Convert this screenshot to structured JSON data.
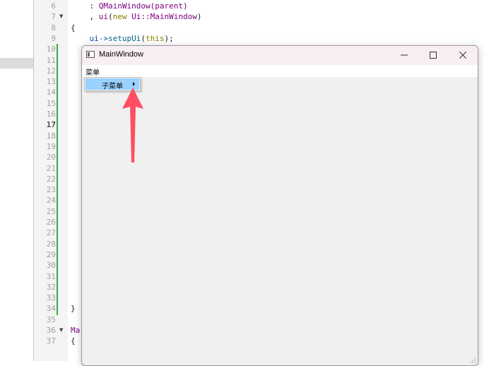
{
  "editor": {
    "lines": [
      {
        "num": "6",
        "tokens": [
          {
            "t": "    : ",
            "c": ""
          },
          {
            "t": "QMainWindow",
            "c": "cls"
          },
          {
            "t": "(parent)",
            "c": "cls"
          }
        ]
      },
      {
        "num": "7",
        "tokens": [
          {
            "t": "    , ",
            "c": ""
          },
          {
            "t": "ui",
            "c": "cls"
          },
          {
            "t": "(",
            "c": ""
          },
          {
            "t": "new",
            "c": "kw"
          },
          {
            "t": " Ui::",
            "c": "cls"
          },
          {
            "t": "MainWindow",
            "c": "cls"
          },
          {
            "t": ")",
            "c": ""
          }
        ]
      },
      {
        "num": "8",
        "tokens": [
          {
            "t": "{",
            "c": ""
          }
        ]
      },
      {
        "num": "9",
        "tokens": [
          {
            "t": "    ui->",
            "c": "var"
          },
          {
            "t": "setupUi",
            "c": "fn"
          },
          {
            "t": "(",
            "c": ""
          },
          {
            "t": "this",
            "c": "kw"
          },
          {
            "t": ");",
            "c": ""
          }
        ]
      },
      {
        "num": "10",
        "tokens": []
      },
      {
        "num": "11",
        "tokens": []
      },
      {
        "num": "12",
        "tokens": []
      },
      {
        "num": "13",
        "tokens": []
      },
      {
        "num": "14",
        "tokens": []
      },
      {
        "num": "15",
        "tokens": []
      },
      {
        "num": "16",
        "tokens": []
      },
      {
        "num": "17",
        "tokens": []
      },
      {
        "num": "18",
        "tokens": []
      },
      {
        "num": "19",
        "tokens": []
      },
      {
        "num": "20",
        "tokens": []
      },
      {
        "num": "21",
        "tokens": []
      },
      {
        "num": "22",
        "tokens": []
      },
      {
        "num": "23",
        "tokens": []
      },
      {
        "num": "24",
        "tokens": []
      },
      {
        "num": "25",
        "tokens": []
      },
      {
        "num": "26",
        "tokens": []
      },
      {
        "num": "27",
        "tokens": []
      },
      {
        "num": "28",
        "tokens": []
      },
      {
        "num": "29",
        "tokens": []
      },
      {
        "num": "30",
        "tokens": []
      },
      {
        "num": "31",
        "tokens": []
      },
      {
        "num": "32",
        "tokens": []
      },
      {
        "num": "33",
        "tokens": []
      },
      {
        "num": "34",
        "tokens": [
          {
            "t": "}",
            "c": ""
          }
        ]
      },
      {
        "num": "35",
        "tokens": []
      },
      {
        "num": "36",
        "tokens": [
          {
            "t": "Ma",
            "c": "cls"
          }
        ]
      },
      {
        "num": "37",
        "tokens": [
          {
            "t": "{",
            "c": ""
          }
        ]
      }
    ],
    "current_line": "17",
    "fold_lines": [
      "7",
      "36"
    ]
  },
  "window": {
    "title": "MainWindow",
    "menu": "菜单",
    "submenu": "子菜单",
    "icons": {
      "app": "window-app-icon",
      "minimize": "minimize-icon",
      "maximize": "maximize-icon",
      "close": "close-icon",
      "submenu_arrow": "chevron-right-icon",
      "resize": "resize-grip-icon"
    }
  },
  "annotation": {
    "arrow_color": "#ff4d62",
    "icon": "annotation-arrow-icon"
  },
  "colors": {
    "highlight": "#99d1ff",
    "titlebar": "#f9eef3",
    "change_bar": "#3fa83f"
  }
}
